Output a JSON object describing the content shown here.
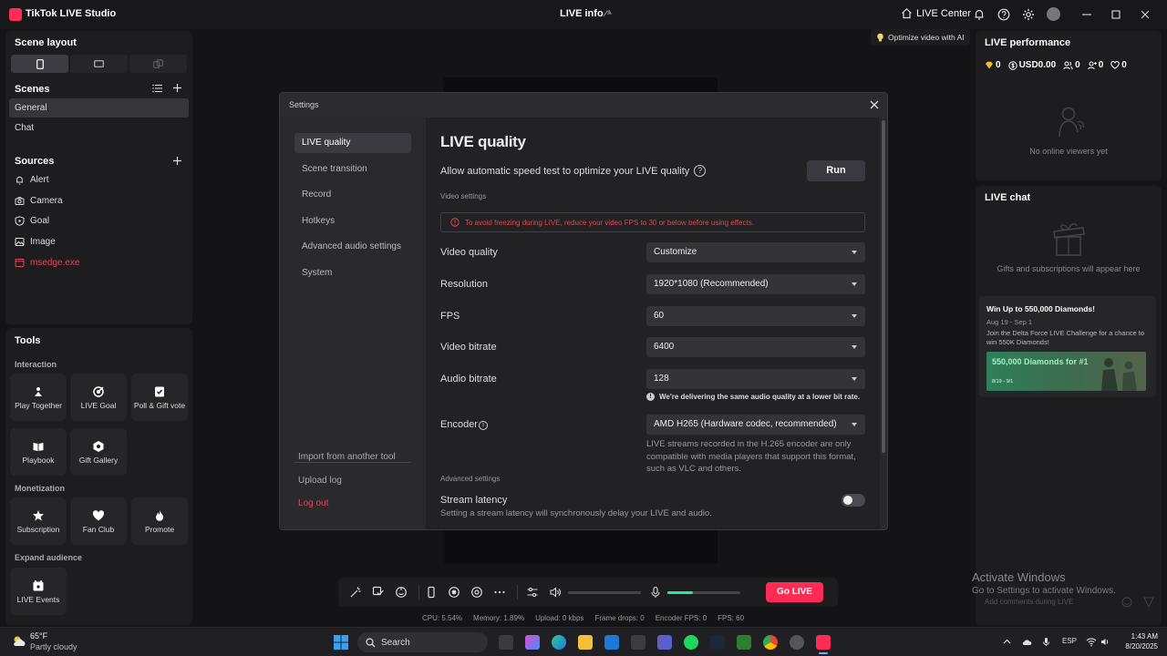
{
  "titlebar": {
    "app_title": "TikTok LIVE Studio",
    "center_title": "LIVE info",
    "live_center": "LIVE Center"
  },
  "left": {
    "scene_layout_title": "Scene layout",
    "scenes_title": "Scenes",
    "scenes": [
      {
        "label": "General"
      },
      {
        "label": "Chat"
      }
    ],
    "sources_title": "Sources",
    "sources": [
      {
        "label": "Alert",
        "icon": "bell-icon"
      },
      {
        "label": "Camera",
        "icon": "camera-icon"
      },
      {
        "label": "Goal",
        "icon": "goal-icon"
      },
      {
        "label": "Image",
        "icon": "image-icon"
      },
      {
        "label": "msedge.exe",
        "icon": "window-icon"
      }
    ],
    "tools_title": "Tools",
    "interaction_title": "Interaction",
    "interaction_tools": [
      "Play Together",
      "LIVE Goal",
      "Poll & Gift vote",
      "Playbook",
      "Gift Gallery"
    ],
    "monetization_title": "Monetization",
    "monetization_tools": [
      "Subscription",
      "Fan Club",
      "Promote"
    ],
    "expand_title": "Expand audience",
    "expand_tools": [
      "LIVE Events"
    ]
  },
  "settings": {
    "title": "Settings",
    "nav": [
      {
        "label": "LIVE quality"
      },
      {
        "label": "Scene transition"
      },
      {
        "label": "Record"
      },
      {
        "label": "Hotkeys"
      },
      {
        "label": "Advanced audio settings"
      },
      {
        "label": "System"
      }
    ],
    "nav_footer": {
      "import": "Import from another tool",
      "upload_log": "Upload log",
      "logout": "Log out"
    },
    "main_title": "LIVE quality",
    "speed_test_label": "Allow automatic speed test to optimize your LIVE quality",
    "run_label": "Run",
    "video_settings_label": "Video settings",
    "warning": "To avoid freezing during LIVE, reduce your video FPS to 30 or below before using effects.",
    "fields": {
      "video_quality": {
        "label": "Video quality",
        "value": "Customize"
      },
      "resolution": {
        "label": "Resolution",
        "value": "1920*1080 (Recommended)"
      },
      "fps": {
        "label": "FPS",
        "value": "60"
      },
      "video_bitrate": {
        "label": "Video bitrate",
        "value": "6400"
      },
      "audio_bitrate": {
        "label": "Audio bitrate",
        "value": "128"
      },
      "encoder": {
        "label": "Encoder",
        "value": "AMD H265 (Hardware codec, recommended)"
      }
    },
    "audio_note": "We're delivering the same audio quality at a lower bit rate.",
    "encoder_note": "LIVE streams recorded in the H.265 encoder are only compatible with media players that support this format, such as VLC and others.",
    "advanced_settings_label": "Advanced settings",
    "latency_title": "Stream latency",
    "latency_desc": "Setting a stream latency will synchronously delay your LIVE and audio."
  },
  "right": {
    "optimize_ai": "Optimize video with AI",
    "performance_title": "LIVE performance",
    "stats": {
      "diamonds": "0",
      "usd": "USD0.00",
      "viewers": "0",
      "followers": "0",
      "likes": "0"
    },
    "no_viewers": "No online viewers yet",
    "chat_title": "LIVE chat",
    "chat_empty": "Gifts and subscriptions will appear here",
    "promo": {
      "title": "Win Up to 550,000 Diamonds!",
      "date": "Aug 19 - Sep 1",
      "desc": "Join the Delta Force LIVE Challenge for a chance to win 550K Diamonds!",
      "banner_text": "550,000 Diamonds for #1",
      "banner_date": "8/19 - 9/1"
    },
    "chat_placeholder": "Add comments during LIVE"
  },
  "bottom": {
    "go_live": "Go LIVE",
    "mic_level": 0.35,
    "stats": {
      "cpu": "CPU: 5.54%",
      "memory": "Memory: 1.89%",
      "upload": "Upload: 0 kbps",
      "frame_drops": "Frame drops: 0",
      "encoder_fps": "Encoder FPS: 0",
      "fps": "FPS: 60"
    }
  },
  "watermark": {
    "title": "Activate Windows",
    "subtitle": "Go to Settings to activate Windows."
  },
  "taskbar": {
    "temp": "65°F",
    "weather": "Partly cloudy",
    "search": "Search",
    "lang": "ESP",
    "time": "1:43 AM",
    "date": "8/20/2025"
  },
  "colors": {
    "accent": "#fe2c55",
    "warning": "#d94a4a",
    "mic_level": "#2fe0b0"
  }
}
